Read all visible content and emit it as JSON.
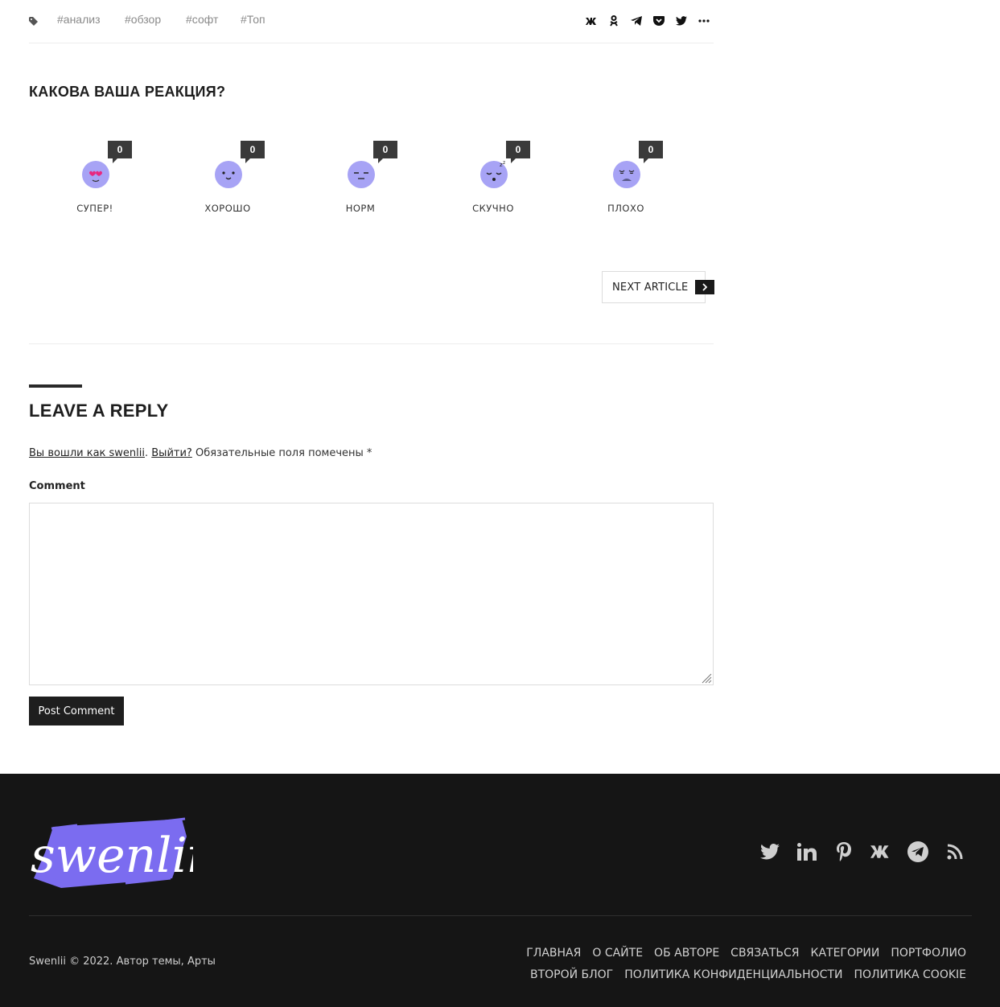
{
  "tags": {
    "icon": "tag-icon",
    "items": [
      "#анализ",
      "#обзор",
      "#софт",
      "#Топ"
    ]
  },
  "share": [
    "vk-icon",
    "odnoklassniki-icon",
    "telegram-icon",
    "pocket-icon",
    "twitter-icon",
    "more-icon"
  ],
  "reaction": {
    "title": "КАКОВА ВАША РЕАКЦИЯ?",
    "items": [
      {
        "label": "СУПЕР!",
        "count": "0",
        "icon": "love-face-icon"
      },
      {
        "label": "ХОРОШО",
        "count": "0",
        "icon": "smile-face-icon"
      },
      {
        "label": "НОРМ",
        "count": "0",
        "icon": "neutral-face-icon"
      },
      {
        "label": "СКУЧНО",
        "count": "0",
        "icon": "sleepy-face-icon"
      },
      {
        "label": "ПЛОХО",
        "count": "0",
        "icon": "sad-face-icon"
      }
    ]
  },
  "next_article": {
    "label": "NEXT ARTICLE"
  },
  "reply": {
    "title": "LEAVE A REPLY",
    "logged_in_as": "Вы вошли как swenlii",
    "logout": "Выйти?",
    "required_note": "Обязательные поля помечены",
    "required_mark": "*",
    "comment_label": "Comment",
    "submit": "Post Comment"
  },
  "footer": {
    "logo_text": "swenlii",
    "social": [
      "twitter-icon",
      "linkedin-icon",
      "pinterest-icon",
      "vk-icon",
      "telegram-icon",
      "rss-icon"
    ],
    "copyright": "Swenlii © 2022. Автор темы, Арты",
    "nav_row1": [
      "ГЛАВНАЯ",
      "О САЙТЕ",
      "ОБ АВТОРЕ",
      "СВЯЗАТЬСЯ",
      "КАТЕГОРИИ",
      "ПОРТФОЛИО"
    ],
    "nav_row2": [
      "ВТОРОЙ БЛОГ",
      "ПОЛИТИКА КОНФИДЕНЦИАЛЬНОСТИ",
      "ПОЛИТИКА COOKIE"
    ]
  },
  "colors": {
    "accent": "#7b6cf0",
    "face": "#a7a3f5",
    "dark": "#151515"
  }
}
